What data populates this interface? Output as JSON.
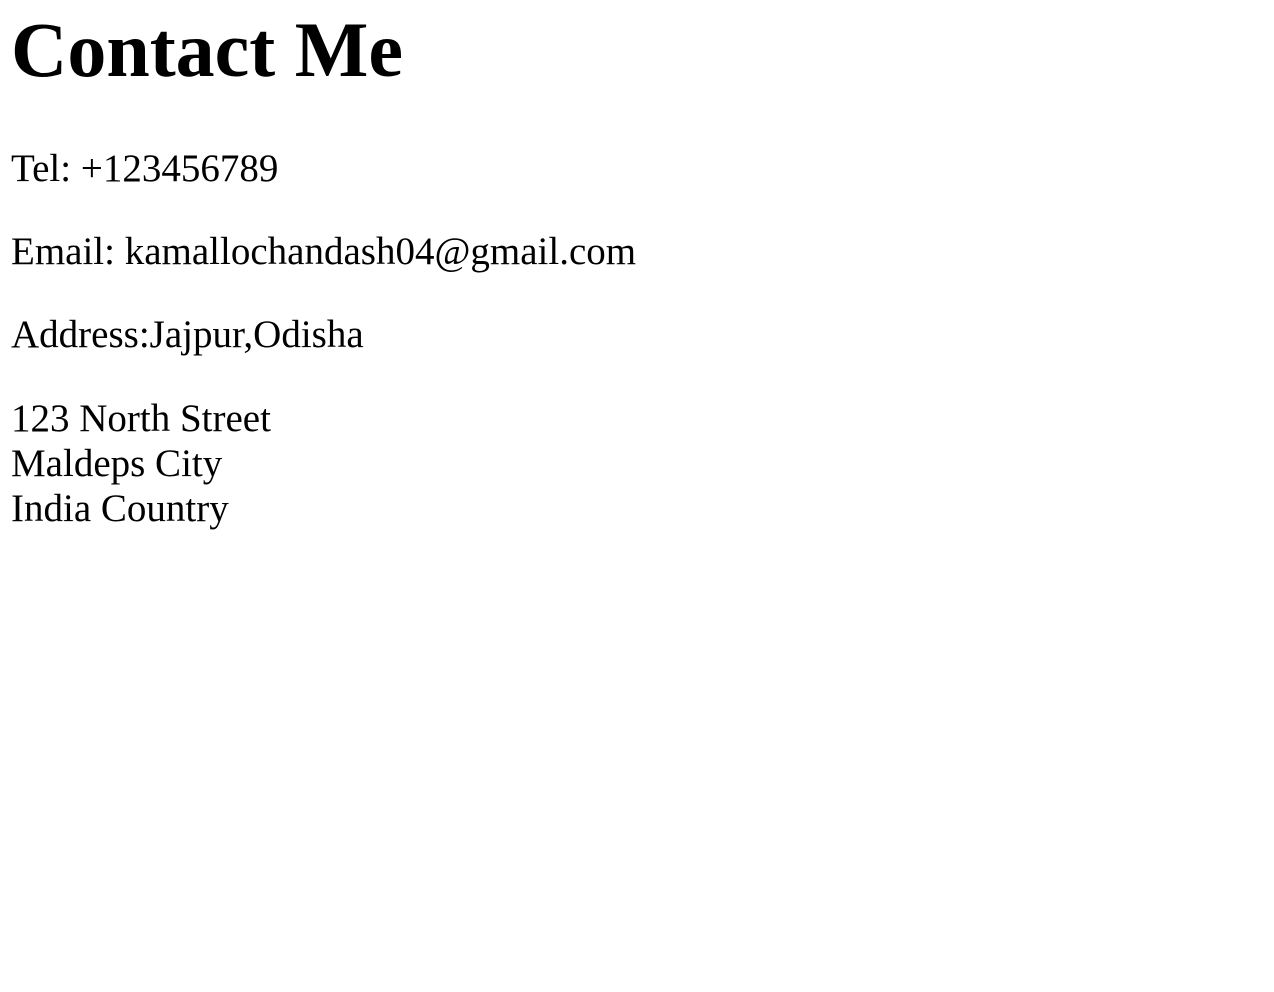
{
  "page": {
    "title": "Contact Me",
    "tel": "Tel: +123456789",
    "email": "Email: kamallochandash04@gmail.com",
    "address": "Address:Jajpur,Odisha",
    "address_lines": [
      "123 North Street",
      "Maldeps City",
      "India Country"
    ]
  }
}
